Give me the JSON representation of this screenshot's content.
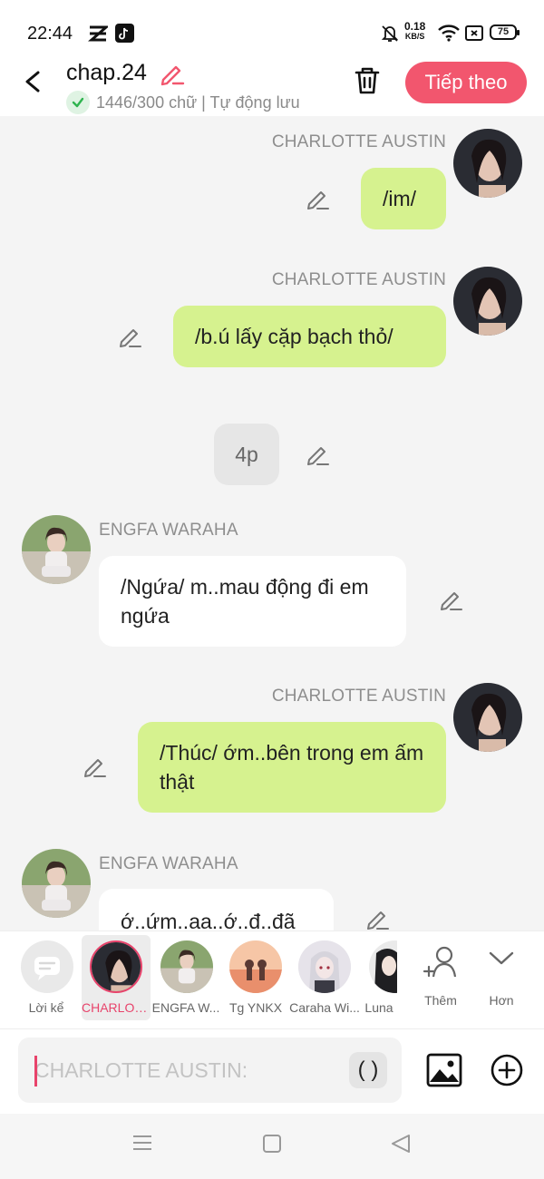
{
  "status_bar": {
    "time": "22:44",
    "speed_value": "0.18",
    "speed_unit": "KB/S",
    "battery": "75"
  },
  "header": {
    "title": "chap.24",
    "subtitle": "1446/300 chữ | Tự động lưu",
    "next_label": "Tiếp theo"
  },
  "messages": [
    {
      "sender": "CHARLOTTE AUSTIN",
      "text": "/im/",
      "side": "right"
    },
    {
      "sender": "CHARLOTTE AUSTIN",
      "text": "/b.ú lấy cặp bạch thỏ/",
      "side": "right"
    },
    {
      "sender": "",
      "text": "4p",
      "side": "center"
    },
    {
      "sender": "ENGFA WARAHA",
      "text": "/Ngứa/ m..mau động đi em ngứa",
      "side": "left"
    },
    {
      "sender": "CHARLOTTE AUSTIN",
      "text": "/Thúc/ ớm..bên trong em ấm thật",
      "side": "right"
    },
    {
      "sender": "ENGFA WARAHA",
      "text": "ớ..ứm..aa..ớ..đ..đã",
      "side": "left"
    }
  ],
  "picker": {
    "items": [
      {
        "label": "Lời kể"
      },
      {
        "label": "CHARLOT..."
      },
      {
        "label": "ENGFA W..."
      },
      {
        "label": "Tg YNKX"
      },
      {
        "label": "Caraha Wi..."
      },
      {
        "label": "Luna"
      }
    ],
    "more_add_label": "Thêm",
    "more_label": "Hơn"
  },
  "input": {
    "placeholder": "CHARLOTTE AUSTIN:",
    "paren_label": "( )"
  },
  "colors": {
    "accent": "#f2566e",
    "bubble_green": "#d6f28f",
    "selected_red": "#e8436b"
  }
}
